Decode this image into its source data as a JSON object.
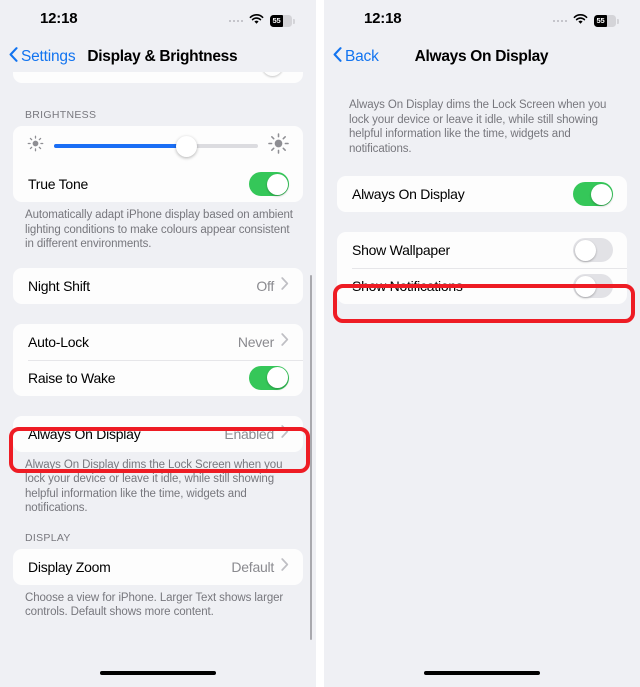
{
  "status_bar": {
    "time": "12:18",
    "battery_percent": "55",
    "wifi_icon": "wifi-icon",
    "signal_icon": "signal-dots-icon",
    "battery_icon": "battery-icon"
  },
  "colors": {
    "accent_blue": "#1274f0",
    "toggle_on_green": "#35c759",
    "toggle_off_gray": "#e2e2e6",
    "slider_blue": "#1a6ef5",
    "highlight_red": "#ee1c24",
    "page_background": "#eff0f4",
    "card_background": "#fdfdfd"
  },
  "left_screen": {
    "nav": {
      "back_label": "Settings",
      "back_icon": "chevron-left-icon",
      "title": "Display & Brightness"
    },
    "brightness": {
      "group_header": "BRIGHTNESS",
      "slider": {
        "name": "brightness-slider",
        "value_percent": 65,
        "low_icon": "brightness-low-icon",
        "high_icon": "brightness-high-icon"
      },
      "true_tone": {
        "label": "True Tone",
        "state": "on"
      },
      "footnote": "Automatically adapt iPhone display based on ambient lighting conditions to make colours appear consistent in different environments."
    },
    "night_shift": {
      "label": "Night Shift",
      "value": "Off",
      "chevron_icon": "chevron-right-icon"
    },
    "lock_group": {
      "auto_lock": {
        "label": "Auto-Lock",
        "value": "Never",
        "chevron_icon": "chevron-right-icon"
      },
      "raise_to_wake": {
        "label": "Raise to Wake",
        "state": "on"
      }
    },
    "always_on_display": {
      "label": "Always On Display",
      "value": "Enabled",
      "chevron_icon": "chevron-right-icon",
      "highlighted": true,
      "footnote": "Always On Display dims the Lock Screen when you lock your device or leave it idle, while still showing helpful information like the time, widgets and notifications."
    },
    "display": {
      "group_header": "DISPLAY",
      "display_zoom": {
        "label": "Display Zoom",
        "value": "Default",
        "chevron_icon": "chevron-right-icon"
      },
      "footnote": "Choose a view for iPhone. Larger Text shows larger controls. Default shows more content."
    }
  },
  "right_screen": {
    "nav": {
      "back_label": "Back",
      "back_icon": "chevron-left-icon",
      "title": "Always On Display"
    },
    "intro_footnote": "Always On Display dims the Lock Screen when you lock your device or leave it idle, while still showing helpful information like the time, widgets and notifications.",
    "always_on_display": {
      "label": "Always On Display",
      "state": "on"
    },
    "show_wallpaper": {
      "label": "Show Wallpaper",
      "state": "off"
    },
    "show_notifications": {
      "label": "Show Notifications",
      "state": "off",
      "highlighted": true
    }
  }
}
